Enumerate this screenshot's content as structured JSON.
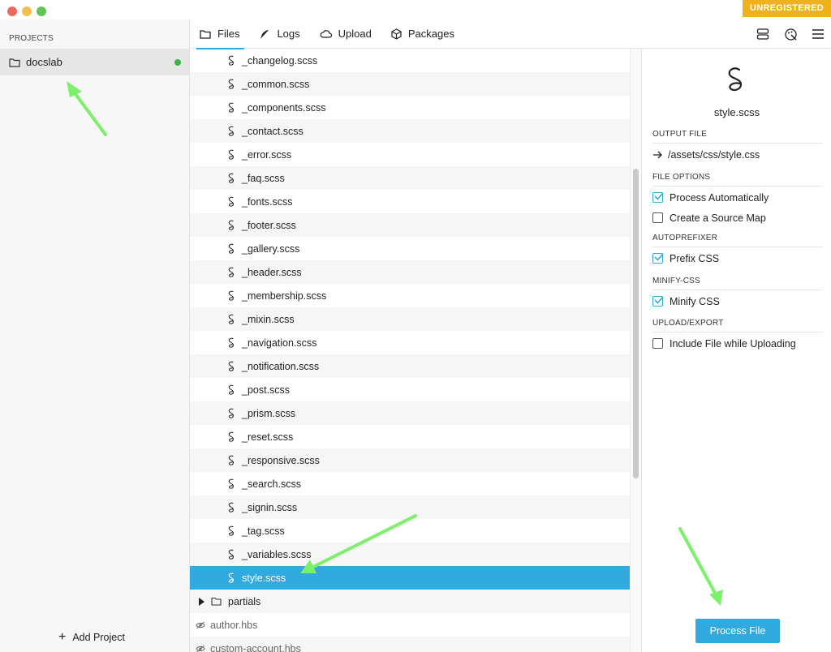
{
  "window": {
    "badge": "UNREGISTERED"
  },
  "sidebar": {
    "heading": "PROJECTS",
    "projects": [
      {
        "label": "docslab",
        "status_color": "#3cb44b"
      }
    ],
    "add_label": "Add Project"
  },
  "tabs": [
    {
      "label": "Files",
      "icon": "folder-icon",
      "active": true
    },
    {
      "label": "Logs",
      "icon": "feather-icon"
    },
    {
      "label": "Upload",
      "icon": "cloud-icon"
    },
    {
      "label": "Packages",
      "icon": "box-icon"
    }
  ],
  "toolbar_icons": [
    "server-icon",
    "palette-icon",
    "menu-icon"
  ],
  "files": [
    "_changelog.scss",
    "_common.scss",
    "_components.scss",
    "_contact.scss",
    "_error.scss",
    "_faq.scss",
    "_fonts.scss",
    "_footer.scss",
    "_gallery.scss",
    "_header.scss",
    "_membership.scss",
    "_mixin.scss",
    "_navigation.scss",
    "_notification.scss",
    "_post.scss",
    "_prism.scss",
    "_reset.scss",
    "_responsive.scss",
    "_search.scss",
    "_signin.scss",
    "_tag.scss",
    "_variables.scss"
  ],
  "selected_file": "style.scss",
  "folder": "partials",
  "hbs_files": [
    "author.hbs",
    "custom-account.hbs"
  ],
  "panel": {
    "filename": "style.scss",
    "output_title": "OUTPUT FILE",
    "output_path": "/assets/css/style.css",
    "file_options_title": "FILE OPTIONS",
    "process_auto": "Process Automatically",
    "source_map": "Create a Source Map",
    "autoprefixer_title": "AUTOPREFIXER",
    "prefix_css": "Prefix CSS",
    "minify_title": "MINIFY-CSS",
    "minify_css": "Minify CSS",
    "upload_title": "UPLOAD/EXPORT",
    "include_upload": "Include File while Uploading",
    "process_button": "Process File"
  },
  "colors": {
    "accent": "#32a9df",
    "badge": "#f0b21b",
    "annotation_arrow": "#7cf06a"
  }
}
